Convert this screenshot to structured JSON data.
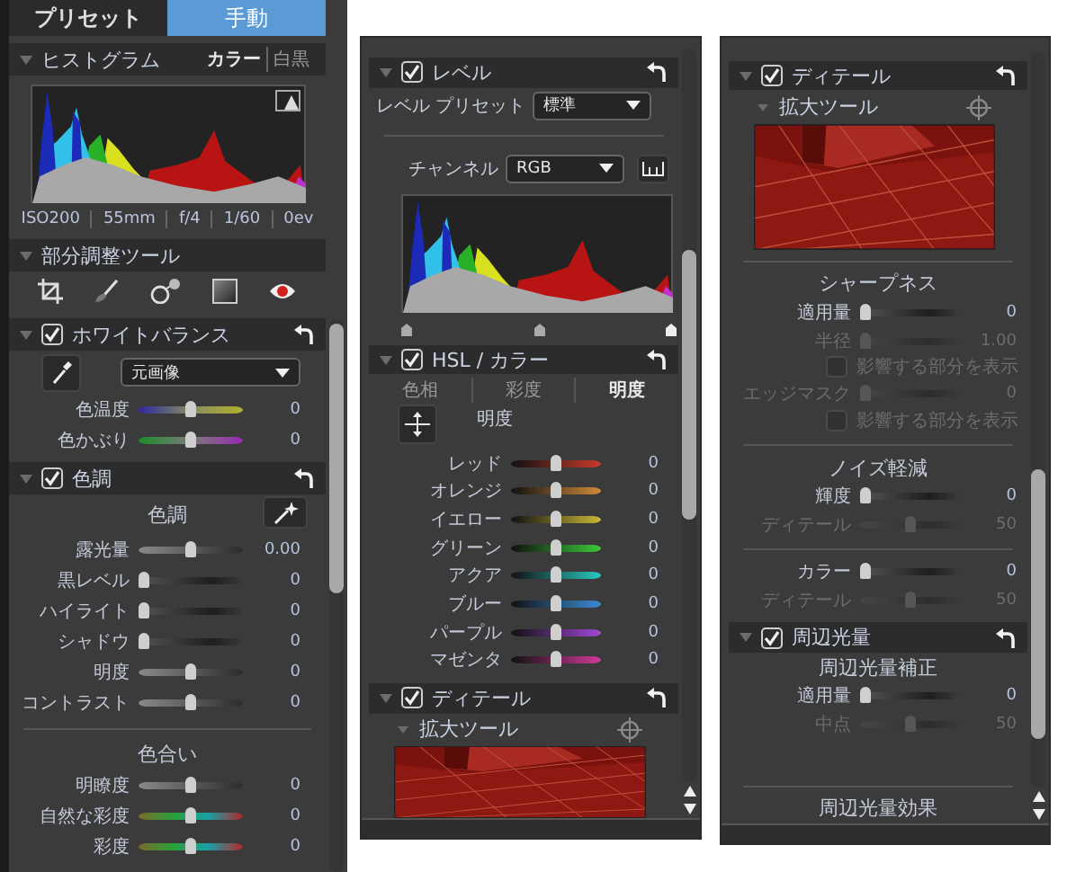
{
  "panels": [
    {
      "blocks": [
        {
          "kind": "main-tabs",
          "items": [
            {
              "label": "プリセット",
              "selected": false
            },
            {
              "label": "手動",
              "selected": true
            }
          ]
        },
        {
          "kind": "header",
          "title": "ヒストグラム",
          "options": [
            {
              "label": "カラー",
              "selected": true
            },
            {
              "label": "白黒",
              "selected": false
            }
          ]
        },
        {
          "kind": "histogram",
          "info": [
            "ISO200",
            "55mm",
            "f/4",
            "1/60",
            "0ev"
          ]
        },
        {
          "kind": "header",
          "title": "部分調整ツール"
        },
        {
          "kind": "tools"
        },
        {
          "kind": "section",
          "title": "ホワイトバランス",
          "checked": true
        },
        {
          "kind": "white-balance",
          "value": "元画像"
        },
        {
          "kind": "slider-temperature",
          "label": "色温度",
          "value": "0",
          "level": 0.5,
          "disabled": false
        },
        {
          "kind": "slider-tint",
          "label": "色かぶり",
          "value": "0",
          "level": 0.5,
          "disabled": false
        },
        {
          "kind": "section",
          "title": "色調",
          "checked": true
        },
        {
          "kind": "subtitle-auto",
          "text": "色調"
        },
        {
          "kind": "slider-gray",
          "label": "露光量",
          "value": "0.00",
          "level": 0.5,
          "disabled": false
        },
        {
          "kind": "slider-dark",
          "label": "黒レベル",
          "value": "0",
          "level": 0,
          "disabled": false
        },
        {
          "kind": "slider-dark",
          "label": "ハイライト",
          "value": "0",
          "level": 0,
          "disabled": false
        },
        {
          "kind": "slider-dark",
          "label": "シャドウ",
          "value": "0",
          "level": 0,
          "disabled": false
        },
        {
          "kind": "slider-gray",
          "label": "明度",
          "value": "0",
          "level": 0.5,
          "disabled": false
        },
        {
          "kind": "slider-gray",
          "label": "コントラスト",
          "value": "0",
          "level": 0.5,
          "disabled": false
        },
        {
          "kind": "divider"
        },
        {
          "kind": "subtitle",
          "text": "色合い"
        },
        {
          "kind": "slider-gray",
          "label": "明瞭度",
          "value": "0",
          "level": 0.5,
          "disabled": false
        },
        {
          "kind": "slider-saturation",
          "label": "自然な彩度",
          "value": "0",
          "level": 0.5,
          "disabled": false
        },
        {
          "kind": "slider-saturation",
          "label": "彩度",
          "value": "0",
          "level": 0.5,
          "disabled": false
        }
      ]
    },
    {
      "blocks": [
        {
          "kind": "section",
          "title": "レベル",
          "checked": true
        },
        {
          "kind": "select",
          "label": "レベル プリセット",
          "value": "標準"
        },
        {
          "kind": "divider"
        },
        {
          "kind": "select-histogram",
          "label": "チャンネル",
          "value": "RGB"
        },
        {
          "kind": "levels"
        },
        {
          "kind": "section",
          "title": "HSL / カラー",
          "checked": true
        },
        {
          "kind": "mode-tabs",
          "items": [
            {
              "label": "色相",
              "selected": false
            },
            {
              "label": "彩度",
              "selected": false
            },
            {
              "label": "明度",
              "selected": true
            }
          ]
        },
        {
          "kind": "adjust-mode",
          "label": "明度"
        },
        {
          "kind": "slider-red",
          "label": "レッド",
          "value": "0",
          "level": 0.5,
          "disabled": false
        },
        {
          "kind": "slider-orange",
          "label": "オレンジ",
          "value": "0",
          "level": 0.5,
          "disabled": false
        },
        {
          "kind": "slider-yellow",
          "label": "イエロー",
          "value": "0",
          "level": 0.5,
          "disabled": false
        },
        {
          "kind": "slider-green",
          "label": "グリーン",
          "value": "0",
          "level": 0.5,
          "disabled": false
        },
        {
          "kind": "slider-aqua",
          "label": "アクア",
          "value": "0",
          "level": 0.5,
          "disabled": false
        },
        {
          "kind": "slider-blue",
          "label": "ブルー",
          "value": "0",
          "level": 0.5,
          "disabled": false
        },
        {
          "kind": "slider-purple",
          "label": "パープル",
          "value": "0",
          "level": 0.5,
          "disabled": false
        },
        {
          "kind": "slider-magenta",
          "label": "マゼンタ",
          "value": "0",
          "level": 0.5,
          "disabled": false
        },
        {
          "kind": "section",
          "title": "ディテール",
          "checked": true
        },
        {
          "kind": "subsection",
          "title": "拡大ツール"
        },
        {
          "kind": "picture"
        }
      ]
    },
    {
      "blocks": [
        {
          "kind": "section",
          "title": "ディテール",
          "checked": true
        },
        {
          "kind": "subsection",
          "title": "拡大ツール"
        },
        {
          "kind": "picture"
        },
        {
          "kind": "divider"
        },
        {
          "kind": "subtitle",
          "text": "シャープネス"
        },
        {
          "kind": "slider-dark",
          "label": "適用量",
          "value": "0",
          "level": 0,
          "disabled": false
        },
        {
          "kind": "slider-dark",
          "label": "半径",
          "value": "1.00",
          "level": 0,
          "disabled": true
        },
        {
          "kind": "checkbox",
          "label": "影響する部分を表示",
          "checked": false,
          "disabled": true
        },
        {
          "kind": "slider-dark",
          "label": "エッジマスク",
          "value": "0",
          "level": 0,
          "disabled": true
        },
        {
          "kind": "checkbox",
          "label": "影響する部分を表示",
          "checked": false,
          "disabled": true
        },
        {
          "kind": "divider"
        },
        {
          "kind": "subtitle",
          "text": "ノイズ軽減"
        },
        {
          "kind": "slider-dark",
          "label": "輝度",
          "value": "0",
          "level": 0,
          "disabled": false
        },
        {
          "kind": "slider-dark",
          "label": "ディテール",
          "value": "50",
          "level": 0.5,
          "disabled": true
        },
        {
          "kind": "divider"
        },
        {
          "kind": "slider-dark",
          "label": "カラー",
          "value": "0",
          "level": 0,
          "disabled": false
        },
        {
          "kind": "slider-dark",
          "label": "ディテール",
          "value": "50",
          "level": 0.5,
          "disabled": true
        },
        {
          "kind": "section",
          "title": "周辺光量",
          "checked": true
        },
        {
          "kind": "subtitle",
          "text": "周辺光量補正"
        },
        {
          "kind": "slider-dark",
          "label": "適用量",
          "value": "0",
          "level": 0,
          "disabled": false
        },
        {
          "kind": "slider-dark",
          "label": "中点",
          "value": "50",
          "level": 0.5,
          "disabled": true
        },
        {
          "kind": "divider"
        },
        {
          "kind": "subtitle",
          "text": "周辺光量効果"
        }
      ]
    }
  ]
}
